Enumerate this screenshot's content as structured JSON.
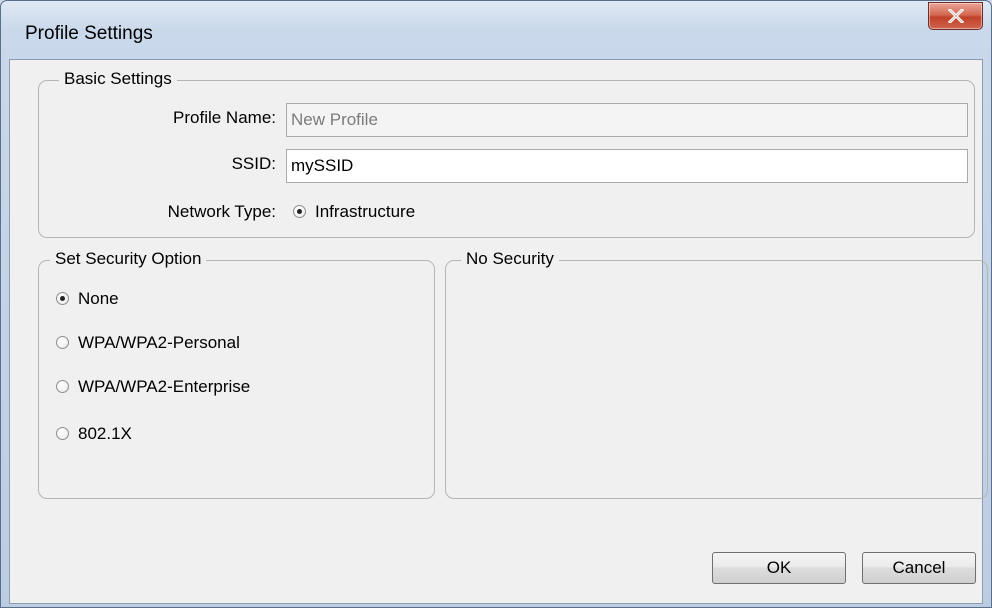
{
  "window": {
    "title": "Profile Settings"
  },
  "basic_settings": {
    "legend": "Basic Settings",
    "profile_name": {
      "label": "Profile Name:",
      "value": "New Profile"
    },
    "ssid": {
      "label": "SSID:",
      "value": "mySSID"
    },
    "network_type": {
      "label": "Network Type:",
      "option": "Infrastructure",
      "selected": true
    }
  },
  "security_option": {
    "legend": "Set Security Option",
    "options": [
      {
        "label": "None",
        "selected": true
      },
      {
        "label": "WPA/WPA2-Personal",
        "selected": false
      },
      {
        "label": "WPA/WPA2-Enterprise",
        "selected": false
      },
      {
        "label": "802.1X",
        "selected": false
      }
    ]
  },
  "security_details": {
    "legend": "No Security"
  },
  "buttons": {
    "ok": "OK",
    "cancel": "Cancel"
  },
  "colors": {
    "close_button": "#c9513b",
    "dialog_background": "#f0f0f0",
    "frame": "#bccde3"
  }
}
